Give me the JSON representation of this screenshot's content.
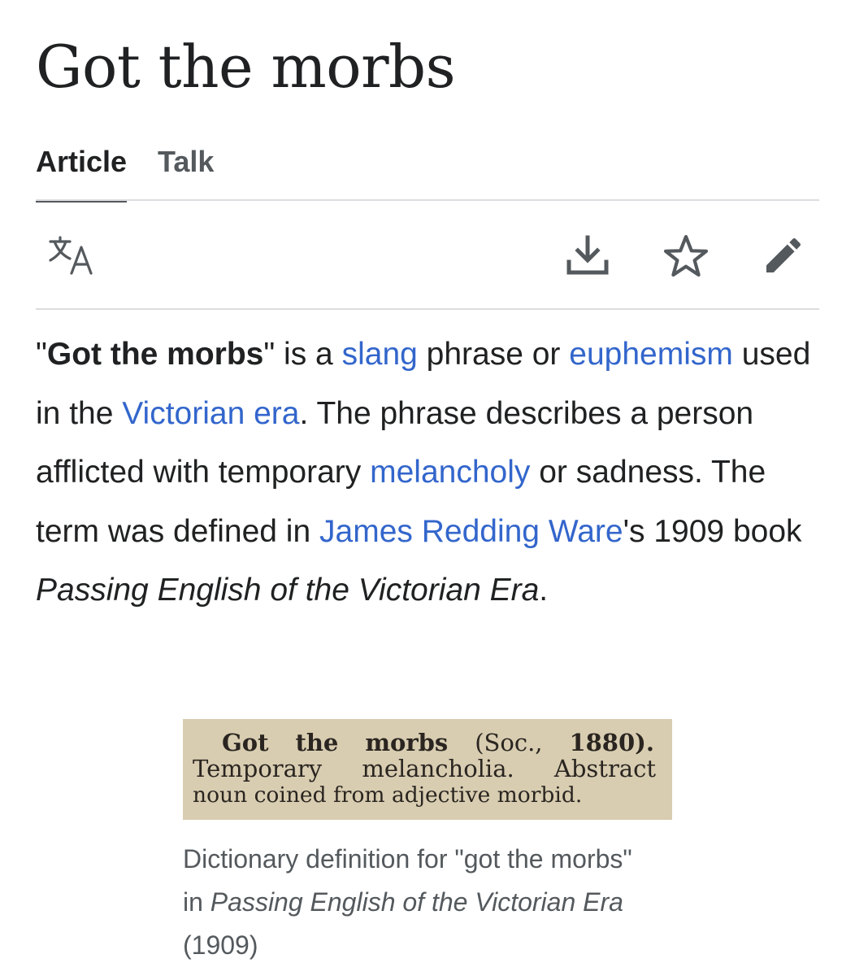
{
  "page": {
    "title": "Got the morbs"
  },
  "tabs": [
    {
      "label": "Article",
      "active": true
    },
    {
      "label": "Talk",
      "active": false
    }
  ],
  "toolbar": {
    "icons": [
      "translate-icon",
      "download-icon",
      "star-icon",
      "pencil-icon"
    ]
  },
  "article": {
    "q1": "\"",
    "bold_term": "Got the morbs",
    "t1": "\" is a ",
    "link_slang": "slang",
    "t2": " phrase or ",
    "link_euphemism": "euphemism",
    "t3": " used in the ",
    "link_victorian_era": "Victorian era",
    "t4": ". The phrase describes a person afflicted with temporary ",
    "link_melancholy": "melancholy",
    "t5": " or sadness. The term was defined in ",
    "link_author": "James Redding Ware",
    "t6": "'s 1909 book ",
    "book_title": "Passing English of the Victorian Era",
    "t7": "."
  },
  "figure": {
    "scan_line1": [
      "Got",
      "the",
      "morbs",
      "(Soc.,",
      "1880)."
    ],
    "scan_line2": [
      "Temporary",
      "melancholia.",
      "Abstract"
    ],
    "scan_line3": "noun coined from adjective morbid.",
    "caption_1": "Dictionary definition for \"got the morbs\" in ",
    "caption_book": "Passing English of the Victorian Era",
    "caption_2": " (1909)"
  },
  "colors": {
    "link": "#3366cc",
    "text": "#202122",
    "secondary": "#54595d",
    "scan_paper": "#d8cdb1"
  }
}
